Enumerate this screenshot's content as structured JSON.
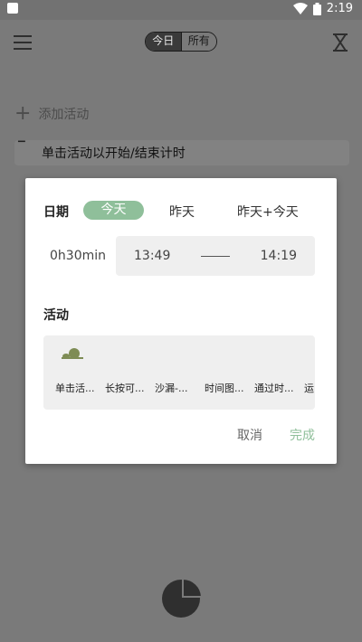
{
  "status_bar": {
    "time": "2:19"
  },
  "app_bar": {
    "segment": {
      "left_label": "今日",
      "right_label": "所有"
    }
  },
  "list": {
    "add_label": "添加活动",
    "hint_label": "单击活动以开始/结束计时"
  },
  "dialog": {
    "date_label": "日期",
    "date_options": [
      "今天",
      "昨天",
      "昨天+今天"
    ],
    "selected_date": "今天",
    "duration": "0h30min",
    "start_time": "13:49",
    "end_time": "14:19",
    "activity_label": "活动",
    "activities": [
      "单击活...",
      "长按可...",
      "沙漏-...",
      "时间图...",
      "通过时...",
      "运"
    ],
    "cancel_label": "取消",
    "done_label": "完成"
  },
  "colors": {
    "accent": "#8fbf9a",
    "scrim_background": "#7a7a7a",
    "dialog_background": "#ffffff"
  },
  "icons": [
    "menu-icon",
    "hourglass-icon",
    "plus-icon",
    "plant-icon",
    "pie-chart-icon",
    "wifi-icon",
    "battery-icon"
  ]
}
